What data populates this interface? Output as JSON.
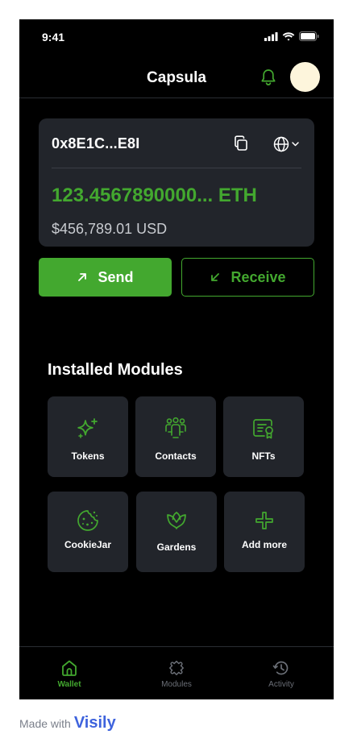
{
  "status_bar": {
    "time": "9:41"
  },
  "header": {
    "title": "Capsula"
  },
  "wallet": {
    "address": "0x8E1C...E8I",
    "balance_eth": "123.4567890000... ETH",
    "balance_usd": "$456,789.01 USD"
  },
  "actions": {
    "send_label": "Send",
    "receive_label": "Receive"
  },
  "modules": {
    "title": "Installed Modules",
    "items": [
      {
        "label": "Tokens",
        "icon": "sparkles-icon"
      },
      {
        "label": "Contacts",
        "icon": "users-icon"
      },
      {
        "label": "NFTs",
        "icon": "certificate-icon"
      },
      {
        "label": "CookieJar",
        "icon": "cookie-icon"
      },
      {
        "label": "Gardens",
        "icon": "tulip-icon"
      },
      {
        "label": "Add more",
        "icon": "plus-icon"
      }
    ]
  },
  "tab_bar": {
    "items": [
      {
        "label": "Wallet",
        "icon": "home-icon",
        "active": true
      },
      {
        "label": "Modules",
        "icon": "puzzle-icon",
        "active": false
      },
      {
        "label": "Activity",
        "icon": "history-icon",
        "active": false
      }
    ]
  },
  "footer": {
    "made_with": "Made with",
    "brand": "Visily"
  },
  "colors": {
    "accent": "#43a82f",
    "background": "#000000",
    "card": "#22252b",
    "avatar": "#fdf5dc",
    "tab_inactive": "#6b6f77",
    "brand": "#3e63dd"
  }
}
